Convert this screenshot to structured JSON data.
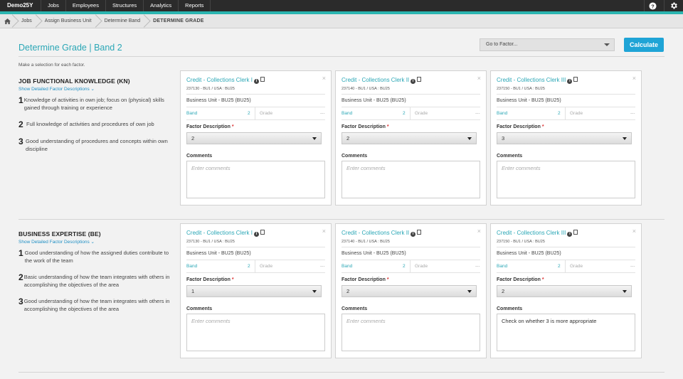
{
  "nav": {
    "brand": "Demo25Y",
    "items": [
      "Jobs",
      "Employees",
      "Structures",
      "Analytics",
      "Reports"
    ]
  },
  "breadcrumb": [
    "Jobs",
    "Assign Business Unit",
    "Determine Band",
    "DETERMINE GRADE"
  ],
  "page": {
    "title": "Determine Grade | Band 2",
    "goto_placeholder": "Go to Factor...",
    "calculate_label": "Calculate",
    "instruction": "Make a selection for each factor."
  },
  "labels": {
    "show_detail": "Show Detailed Factor Descriptions",
    "band": "Band",
    "grade": "Grade",
    "grade_value": "---",
    "factor_description": "Factor Description",
    "required_mark": "*",
    "comments": "Comments",
    "comments_placeholder": "Enter comments",
    "close": "×"
  },
  "jobs": [
    {
      "name": "Credit - Collections Clerk I",
      "code": "237130 - BU1 / USA : BU25",
      "business_unit": "Business Unit - BU25 (BU25)",
      "band": "2"
    },
    {
      "name": "Credit - Collections Clerk II",
      "code": "237140 - BU1 / USA : BU25",
      "business_unit": "Business Unit - BU25 (BU25)",
      "band": "2"
    },
    {
      "name": "Credit - Collections Clerk III",
      "code": "237150 - BU1 / USA : BU25",
      "business_unit": "Business Unit - BU25 (BU25)",
      "band": "2"
    }
  ],
  "factors": [
    {
      "title": "JOB FUNCTIONAL KNOWLEDGE (KN)",
      "levels": [
        {
          "num": "1",
          "text": "Knowledge of activities in own job; focus on (physical) skills gained through training or experience"
        },
        {
          "num": "2",
          "text": "Full knowledge of activities and procedures of own job"
        },
        {
          "num": "3",
          "text": "Good understanding of procedures and concepts within own discipline"
        }
      ],
      "selections": [
        "2",
        "2",
        "3"
      ],
      "comments": [
        "",
        "",
        ""
      ]
    },
    {
      "title": "BUSINESS EXPERTISE (BE)",
      "levels": [
        {
          "num": "1",
          "text": "Good understanding of how the assigned duties contribute to the work of the team"
        },
        {
          "num": "2",
          "text": "Basic understanding of how the team integrates with others in accomplishing the objectives of the area"
        },
        {
          "num": "3",
          "text": "Good understanding of how the team integrates with others in accomplishing the objectives of the area"
        }
      ],
      "selections": [
        "1",
        "2",
        "2"
      ],
      "comments": [
        "",
        "",
        "Check on whether 3 is more appropriate"
      ]
    }
  ],
  "colors": {
    "accent": "#2bb5b0",
    "link": "#2ba7b6",
    "button": "#1fa4d6",
    "nav_bg": "#2b2b2b"
  },
  "icons": [
    "home-icon",
    "help-icon",
    "gear-icon",
    "info-icon",
    "document-icon",
    "close-icon",
    "caret-down-icon"
  ]
}
